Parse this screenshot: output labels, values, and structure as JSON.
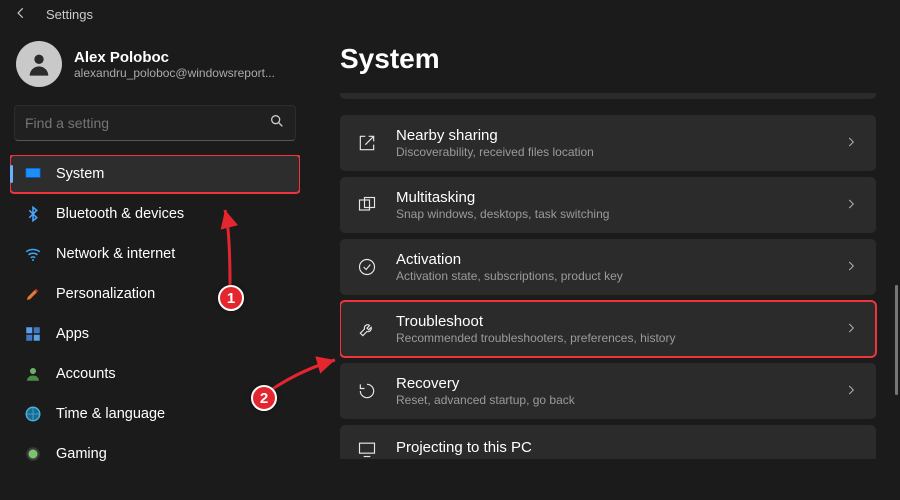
{
  "titlebar": {
    "title": "Settings"
  },
  "profile": {
    "name": "Alex Poloboc",
    "email": "alexandru_poloboc@windowsreport..."
  },
  "search": {
    "placeholder": "Find a setting"
  },
  "sidebar": {
    "items": [
      {
        "label": "System"
      },
      {
        "label": "Bluetooth & devices"
      },
      {
        "label": "Network & internet"
      },
      {
        "label": "Personalization"
      },
      {
        "label": "Apps"
      },
      {
        "label": "Accounts"
      },
      {
        "label": "Time & language"
      },
      {
        "label": "Gaming"
      }
    ]
  },
  "page": {
    "heading": "System"
  },
  "cards": [
    {
      "title": "Nearby sharing",
      "sub": "Discoverability, received files location"
    },
    {
      "title": "Multitasking",
      "sub": "Snap windows, desktops, task switching"
    },
    {
      "title": "Activation",
      "sub": "Activation state, subscriptions, product key"
    },
    {
      "title": "Troubleshoot",
      "sub": "Recommended troubleshooters, preferences, history"
    },
    {
      "title": "Recovery",
      "sub": "Reset, advanced startup, go back"
    },
    {
      "title": "Projecting to this PC",
      "sub": ""
    }
  ],
  "annotations": {
    "step1": "1",
    "step2": "2"
  }
}
